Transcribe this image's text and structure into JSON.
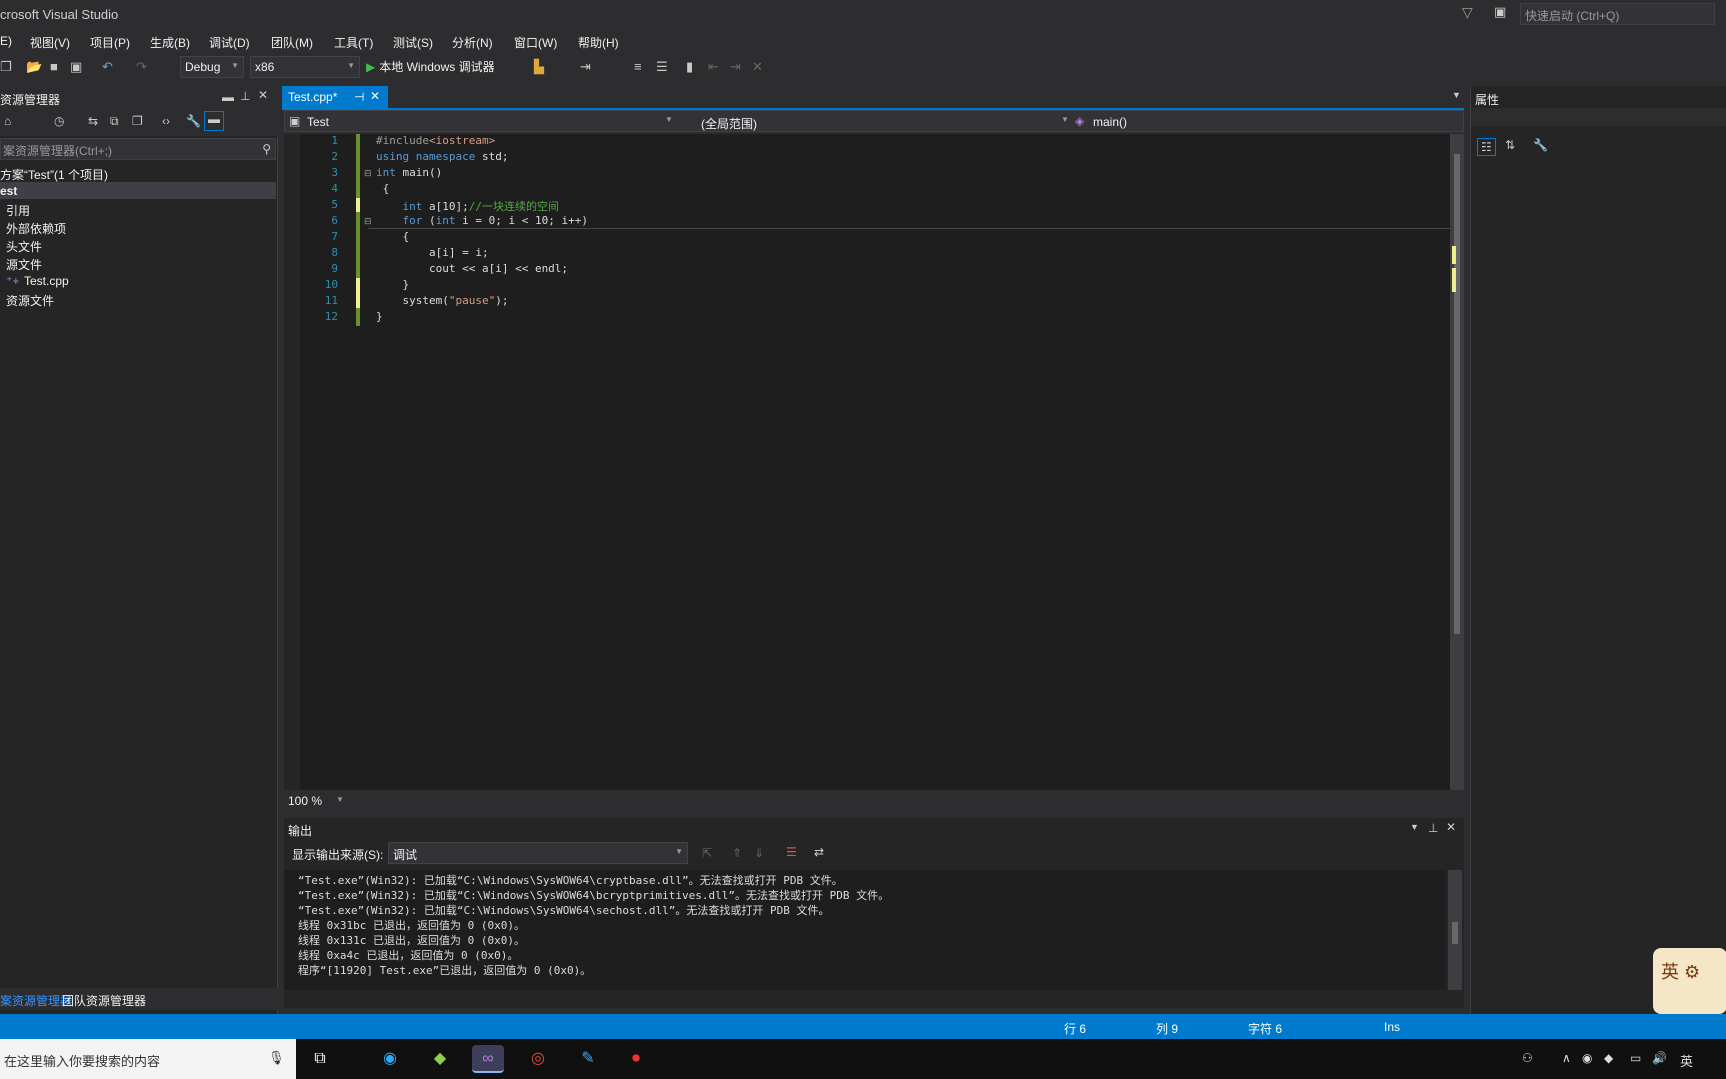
{
  "window": {
    "title": "crosoft Visual Studio",
    "quick_launch_placeholder": "快速启动 (Ctrl+Q)"
  },
  "menu": [
    "E)",
    "视图(V)",
    "项目(P)",
    "生成(B)",
    "调试(D)",
    "团队(M)",
    "工具(T)",
    "测试(S)",
    "分析(N)",
    "窗口(W)",
    "帮助(H)"
  ],
  "toolbar": {
    "config": "Debug",
    "platform": "x86",
    "run_label": "本地 Windows 调试器"
  },
  "solution_explorer": {
    "title": "资源管理器",
    "search_placeholder": "案资源管理器(Ctrl+;)",
    "tree": [
      "方案“Test”(1 个项目)",
      "est",
      "引用",
      "外部依赖项",
      "头文件",
      "源文件",
      "Test.cpp",
      "资源文件"
    ],
    "tabs": [
      "案资源管理器",
      "团队资源管理器"
    ]
  },
  "editor": {
    "tab_label": "Test.cpp*",
    "nav": {
      "project": "Test",
      "scope": "(全局范围)",
      "member": "main()"
    },
    "line_numbers": [
      "1",
      "2",
      "3",
      "4",
      "5",
      "6",
      "7",
      "8",
      "9",
      "10",
      "11",
      "12"
    ],
    "zoom": "100 %"
  },
  "output": {
    "title": "输出",
    "source_label": "显示输出来源(S):",
    "source_value": "调试",
    "lines": [
      "“Test.exe”(Win32): 已加载“C:\\Windows\\SysWOW64\\cryptbase.dll”。无法查找或打开 PDB 文件。",
      "“Test.exe”(Win32): 已加载“C:\\Windows\\SysWOW64\\bcryptprimitives.dll”。无法查找或打开 PDB 文件。",
      "“Test.exe”(Win32): 已加载“C:\\Windows\\SysWOW64\\sechost.dll”。无法查找或打开 PDB 文件。",
      "线程 0x31bc 已退出，返回值为 0 (0x0)。",
      "线程 0x131c 已退出，返回值为 0 (0x0)。",
      "线程 0xa4c 已退出，返回值为 0 (0x0)。",
      "程序“[11920] Test.exe”已退出，返回值为 0 (0x0)。"
    ]
  },
  "properties": {
    "title": "属性"
  },
  "status": {
    "line": "行 6",
    "col": "列 9",
    "char": "字符 6",
    "mode": "Ins"
  },
  "taskbar": {
    "search_placeholder": "在这里输入你要搜索的内容",
    "ime": "英"
  },
  "colors": {
    "accent": "#007acc",
    "editor_bg": "#1e1e1e",
    "chrome": "#2d2d30"
  }
}
